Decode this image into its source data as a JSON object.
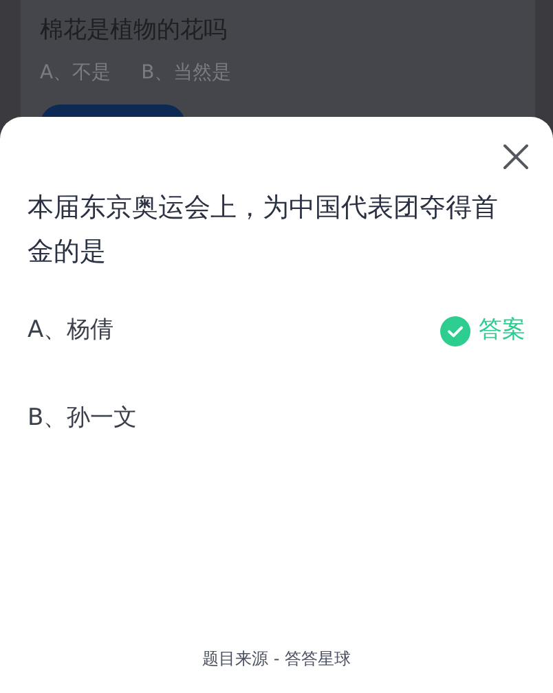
{
  "background_card": {
    "title": "棉花是植物的花吗",
    "options": [
      "A、不是",
      "B、当然是"
    ]
  },
  "sheet": {
    "question": "本届东京奥运会上，为中国代表团夺得首金的是",
    "options": [
      {
        "label": "A、杨倩",
        "answer_badge": "答案"
      },
      {
        "label": "B、孙一文"
      }
    ],
    "source": "题目来源 - 答答星球"
  }
}
